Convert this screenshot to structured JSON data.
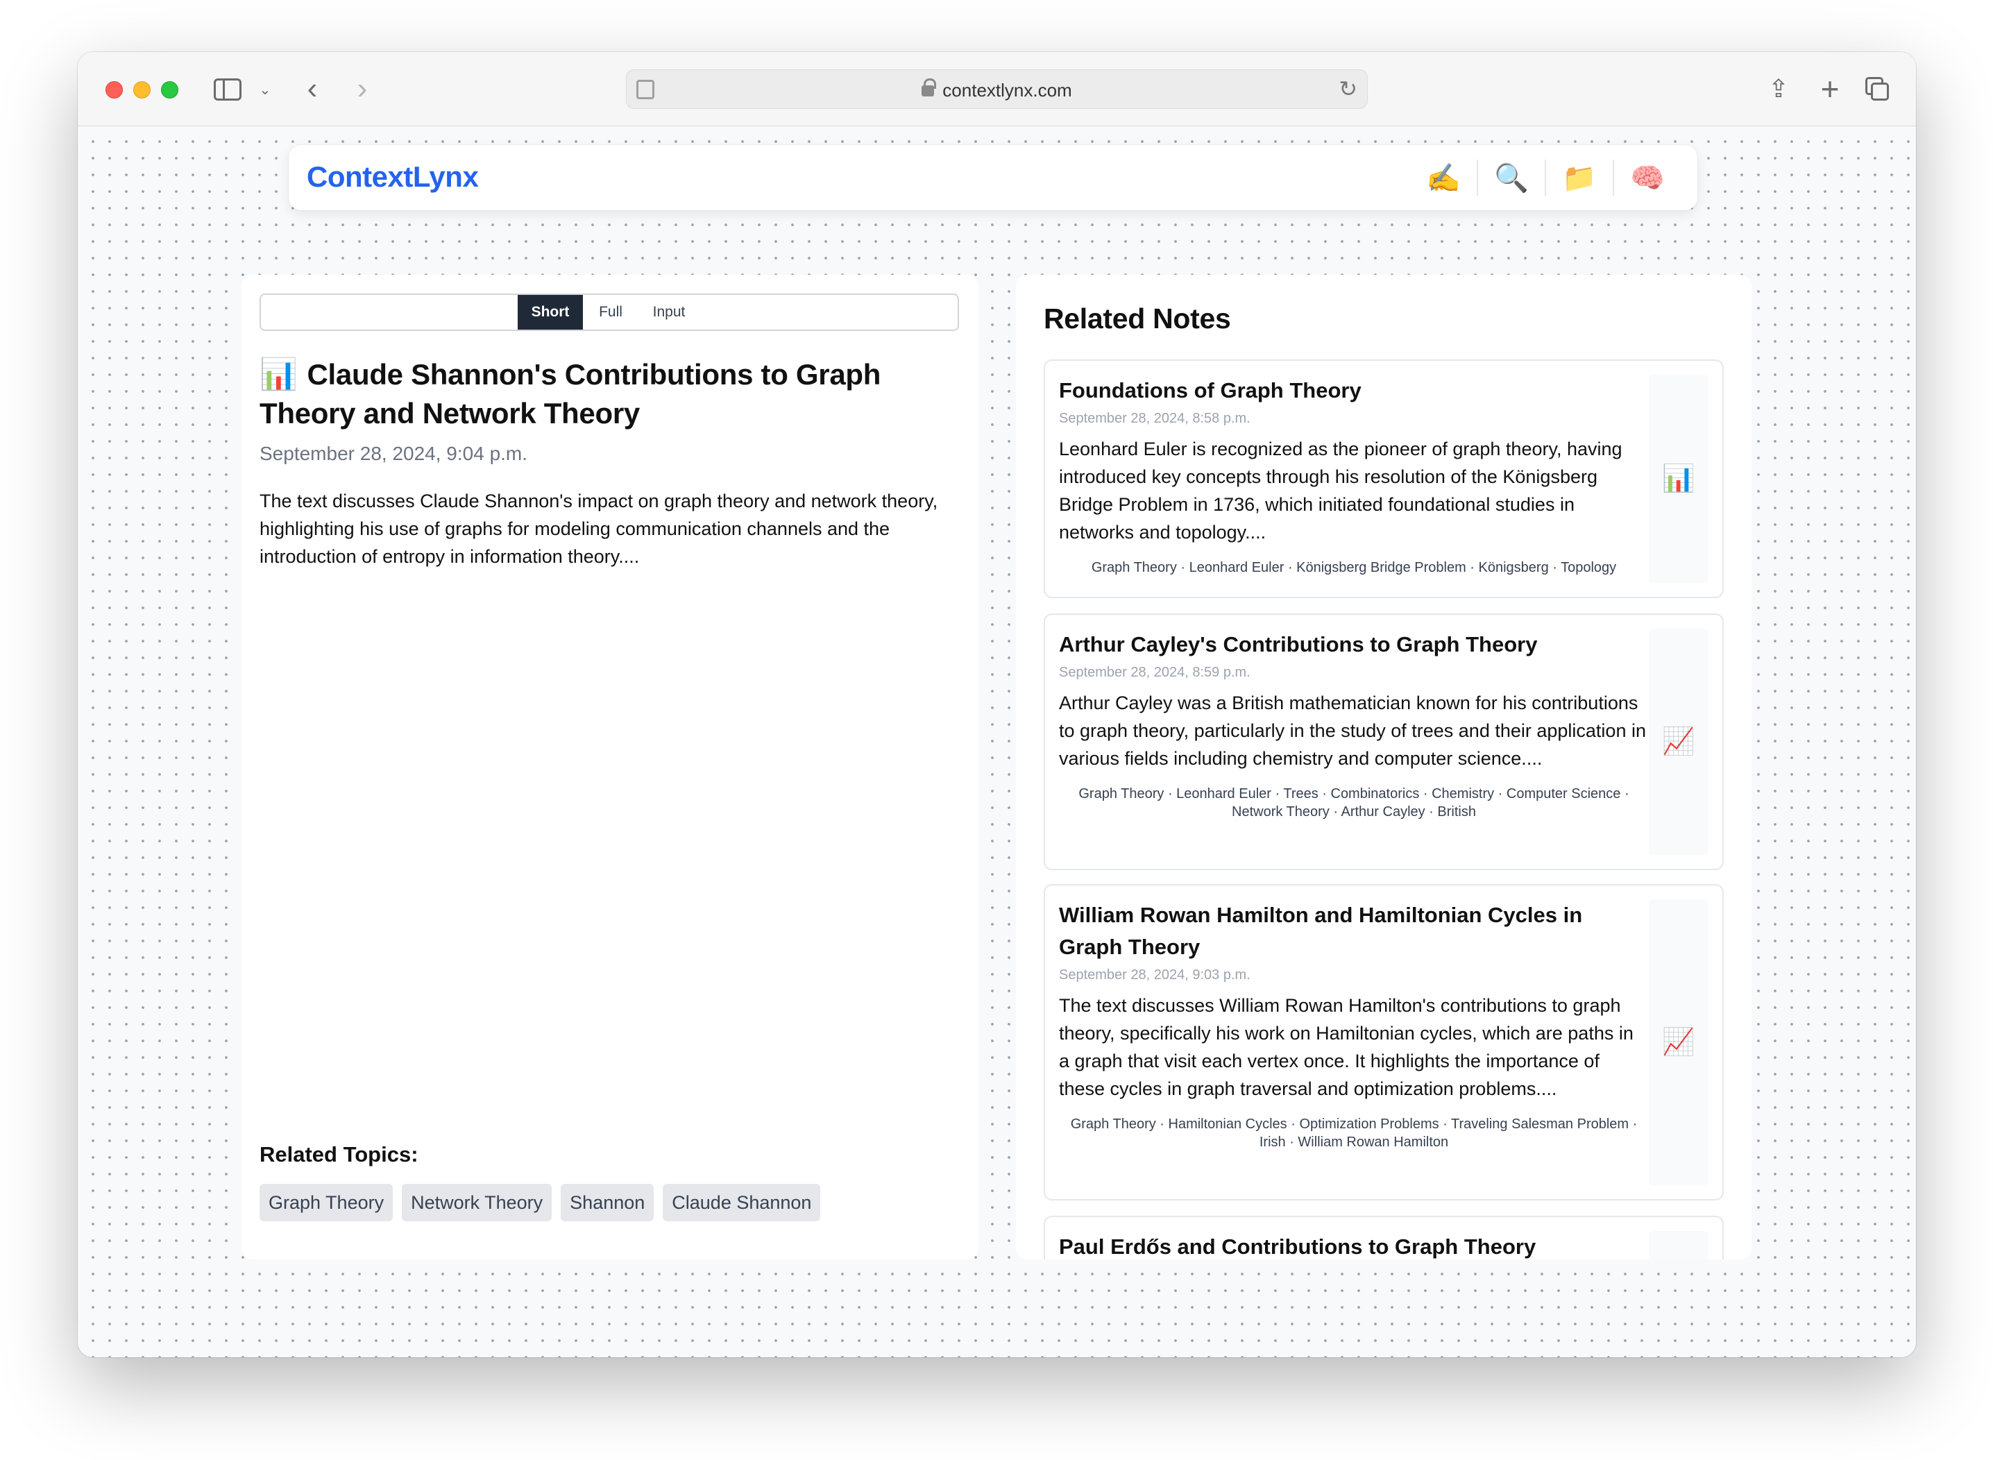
{
  "browser": {
    "url": "contextlynx.com"
  },
  "app": {
    "brand": "ContextLynx",
    "actions": [
      {
        "icon": "writing-hand-icon",
        "glyph": "✍️"
      },
      {
        "icon": "search-icon",
        "glyph": "🔍"
      },
      {
        "icon": "folder-icon",
        "glyph": "📁"
      },
      {
        "icon": "brain-icon",
        "glyph": "🧠"
      }
    ]
  },
  "note": {
    "view_modes": [
      "Short",
      "Full",
      "Input"
    ],
    "selected_view": "Short",
    "emoji": "📊",
    "title": "Claude Shannon's Contributions to Graph Theory and Network Theory",
    "date": "September 28, 2024, 9:04 p.m.",
    "summary": "The text discusses Claude Shannon's impact on graph theory and network theory, highlighting his use of graphs for modeling communication channels and the introduction of entropy in information theory....",
    "related_topics_heading": "Related Topics:",
    "related_topics": [
      "Graph Theory",
      "Network Theory",
      "Shannon",
      "Claude Shannon"
    ]
  },
  "related": {
    "heading": "Related Notes",
    "items": [
      {
        "title": "Foundations of Graph Theory",
        "date": "September 28, 2024, 8:58 p.m.",
        "summary": "Leonhard Euler is recognized as the pioneer of graph theory, having introduced key concepts through his resolution of the Königsberg Bridge Problem in 1736, which initiated foundational studies in networks and topology....",
        "tags": "Graph Theory · Leonhard Euler · Königsberg Bridge Problem · Königsberg · Topology",
        "emoji": "📊"
      },
      {
        "title": "Arthur Cayley's Contributions to Graph Theory",
        "date": "September 28, 2024, 8:59 p.m.",
        "summary": "Arthur Cayley was a British mathematician known for his contributions to graph theory, particularly in the study of trees and their application in various fields including chemistry and computer science....",
        "tags": "Graph Theory · Leonhard Euler · Trees · Combinatorics · Chemistry · Computer Science · Network Theory · Arthur Cayley · British",
        "emoji": "📈"
      },
      {
        "title": "William Rowan Hamilton and Hamiltonian Cycles in Graph Theory",
        "date": "September 28, 2024, 9:03 p.m.",
        "summary": "The text discusses William Rowan Hamilton's contributions to graph theory, specifically his work on Hamiltonian cycles, which are paths in a graph that visit each vertex once. It highlights the importance of these cycles in graph traversal and optimization problems....",
        "tags": "Graph Theory · Hamiltonian Cycles · Optimization Problems · Traveling Salesman Problem · Irish · William Rowan Hamilton",
        "emoji": "📈"
      },
      {
        "title": "Paul Erdős and Contributions to Graph Theory"
      }
    ]
  }
}
